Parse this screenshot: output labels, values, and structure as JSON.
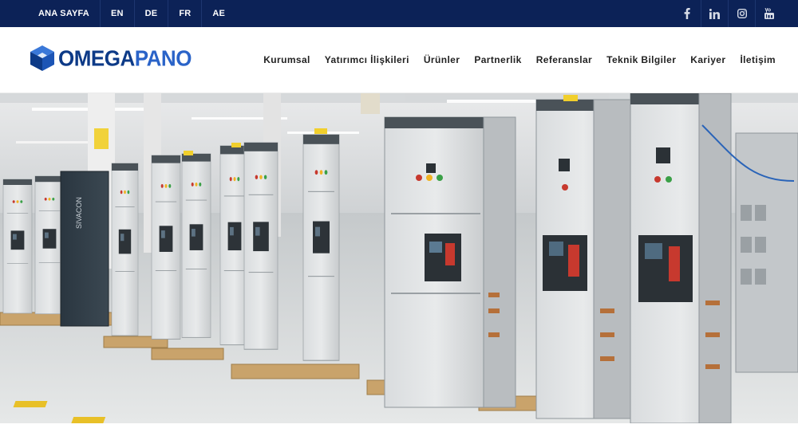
{
  "topbar": {
    "links": [
      {
        "label": "ANA SAYFA"
      },
      {
        "label": "EN"
      },
      {
        "label": "DE"
      },
      {
        "label": "FR"
      },
      {
        "label": "AE"
      }
    ],
    "social_icons": [
      "facebook-icon",
      "linkedin-icon",
      "instagram-icon",
      "youtube-icon"
    ],
    "background": "#0c2257"
  },
  "header": {
    "logo": {
      "part1": "OMEGA",
      "part2": "PANO"
    },
    "nav": [
      {
        "label": "Kurumsal"
      },
      {
        "label": "Yatırımcı İlişkileri"
      },
      {
        "label": "Ürünler"
      },
      {
        "label": "Partnerlik"
      },
      {
        "label": "Referanslar"
      },
      {
        "label": "Teknik Bilgiler"
      },
      {
        "label": "Kariyer"
      },
      {
        "label": "İletişim"
      }
    ]
  },
  "hero": {
    "image": "factory-switchboard-panels-photo",
    "panel_brand": "SIVACON"
  },
  "colors": {
    "brand_dark": "#0c2257",
    "logo_blue": "#0d3a87",
    "logo_light": "#2a63c8"
  }
}
